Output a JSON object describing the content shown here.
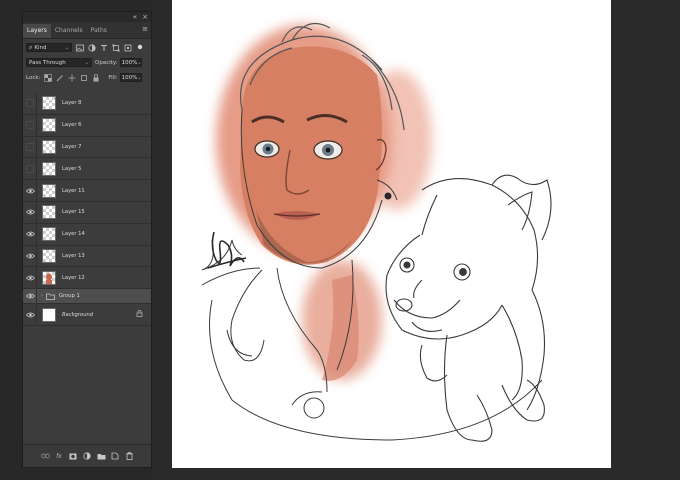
{
  "panel": {
    "collapse_icon": "«",
    "close_icon": "×",
    "tabs": [
      {
        "label": "Layers",
        "active": true
      },
      {
        "label": "Channels",
        "active": false
      },
      {
        "label": "Paths",
        "active": false
      }
    ],
    "menu_icon": "≡"
  },
  "filter": {
    "kind_label": "Kind",
    "icons": [
      "image-filter-icon",
      "adjustment-filter-icon",
      "type-filter-icon",
      "shape-filter-icon",
      "smart-object-filter-icon",
      "filter-toggle-icon"
    ]
  },
  "blend": {
    "mode": "Pass Through",
    "opacity_label": "Opacity:",
    "opacity_value": "100%"
  },
  "lockrow": {
    "lock_label": "Lock:",
    "fill_label": "Fill:",
    "fill_value": "100%"
  },
  "layers": [
    {
      "name": "Layer 8",
      "visible": false,
      "thumb": "transparent"
    },
    {
      "name": "Layer 6",
      "visible": false,
      "thumb": "transparent"
    },
    {
      "name": "Layer 7",
      "visible": false,
      "thumb": "transparent"
    },
    {
      "name": "Layer 5",
      "visible": false,
      "thumb": "transparent"
    },
    {
      "name": "Layer 11",
      "visible": true,
      "thumb": "transparent"
    },
    {
      "name": "Layer 15",
      "visible": true,
      "thumb": "transparent"
    },
    {
      "name": "Layer 14",
      "visible": true,
      "thumb": "transparent"
    },
    {
      "name": "Layer 13",
      "visible": true,
      "thumb": "transparent"
    },
    {
      "name": "Layer 12",
      "visible": true,
      "thumb": "figure"
    },
    {
      "name": "Group 1",
      "visible": true,
      "thumb": "folder",
      "selected": true
    },
    {
      "name": "Background",
      "visible": true,
      "thumb": "white",
      "italic": true,
      "locked": true
    }
  ],
  "bottom_icons": [
    "link-layers-icon",
    "fx-icon",
    "add-mask-icon",
    "adjustment-layer-icon",
    "new-group-icon",
    "new-layer-icon",
    "delete-layer-icon"
  ],
  "colors": {
    "skin": "#d9826a",
    "line": "#3a3a3a",
    "panel_bg": "#3c3c3c",
    "selected_row": "#4e4e4e"
  }
}
